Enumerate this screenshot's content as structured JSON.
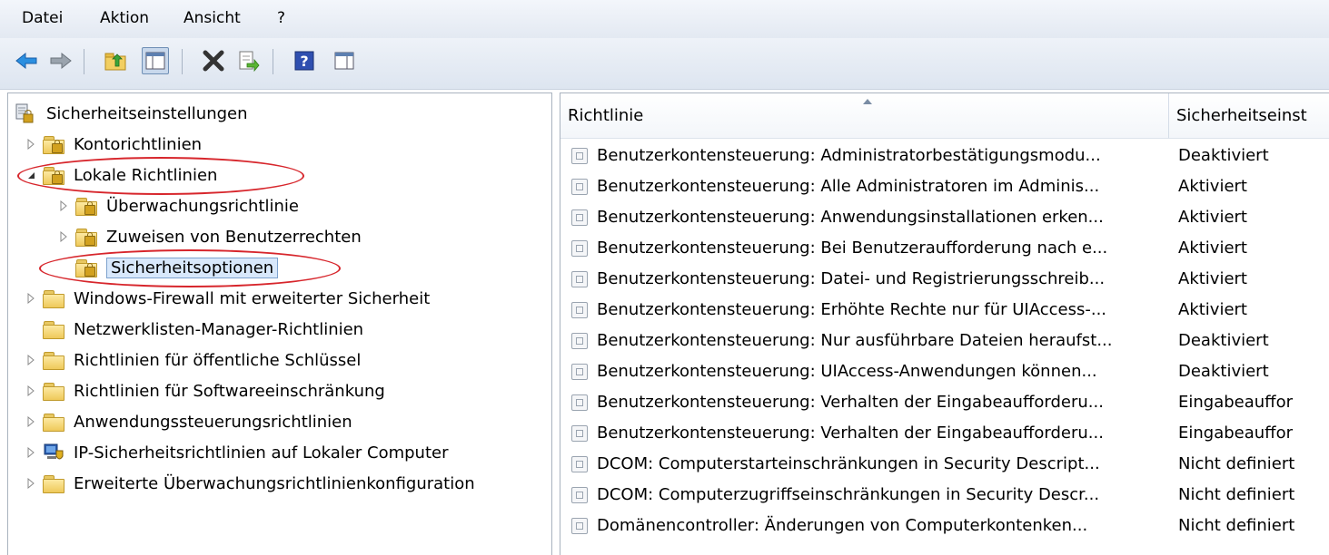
{
  "menu": [
    "Datei",
    "Aktion",
    "Ansicht",
    "?"
  ],
  "toolbar": {
    "icons": [
      "back-arrow-icon",
      "forward-arrow-icon",
      "up-folder-icon",
      "show-hide-console-tree-icon",
      "delete-icon",
      "export-list-icon",
      "help-icon",
      "action-pane-icon"
    ]
  },
  "tree": {
    "root": "Sicherheitseinstellungen",
    "items": [
      "Kontorichtlinien",
      "Lokale Richtlinien",
      "Überwachungsrichtlinie",
      "Zuweisen von Benutzerrechten",
      "Sicherheitsoptionen",
      "Windows-Firewall mit erweiterter Sicherheit",
      "Netzwerklisten-Manager-Richtlinien",
      "Richtlinien für öffentliche Schlüssel",
      "Richtlinien für Softwareeinschränkung",
      "Anwendungssteuerungsrichtlinien",
      "IP-Sicherheitsrichtlinien auf Lokaler Computer",
      "Erweiterte Überwachungsrichtlinienkonfiguration"
    ]
  },
  "list": {
    "columns": [
      "Richtlinie",
      "Sicherheitseinst"
    ],
    "rows": [
      {
        "name": "Benutzerkontensteuerung: Administratorbestätigungsmodu...",
        "value": "Deaktiviert"
      },
      {
        "name": "Benutzerkontensteuerung: Alle Administratoren im Adminis...",
        "value": "Aktiviert"
      },
      {
        "name": "Benutzerkontensteuerung: Anwendungsinstallationen erken...",
        "value": "Aktiviert"
      },
      {
        "name": "Benutzerkontensteuerung: Bei Benutzeraufforderung nach e...",
        "value": "Aktiviert"
      },
      {
        "name": "Benutzerkontensteuerung: Datei- und Registrierungsschreib...",
        "value": "Aktiviert"
      },
      {
        "name": "Benutzerkontensteuerung: Erhöhte Rechte nur für UIAccess-...",
        "value": "Aktiviert"
      },
      {
        "name": "Benutzerkontensteuerung: Nur ausführbare Dateien heraufst...",
        "value": "Deaktiviert"
      },
      {
        "name": "Benutzerkontensteuerung: UIAccess-Anwendungen können...",
        "value": "Deaktiviert"
      },
      {
        "name": "Benutzerkontensteuerung: Verhalten der Eingabeaufforderu...",
        "value": "Eingabeauffor"
      },
      {
        "name": "Benutzerkontensteuerung: Verhalten der Eingabeaufforderu...",
        "value": "Eingabeauffor"
      },
      {
        "name": "DCOM: Computerstarteinschränkungen in Security Descript...",
        "value": "Nicht definiert"
      },
      {
        "name": "DCOM: Computerzugriffseinschränkungen in Security Descr...",
        "value": "Nicht definiert"
      },
      {
        "name": "Domänencontroller: Änderungen von Computerkontenken...",
        "value": "Nicht definiert"
      }
    ]
  },
  "colors": {
    "annotation": "#d7262c",
    "selection": "#d8e8fb"
  }
}
